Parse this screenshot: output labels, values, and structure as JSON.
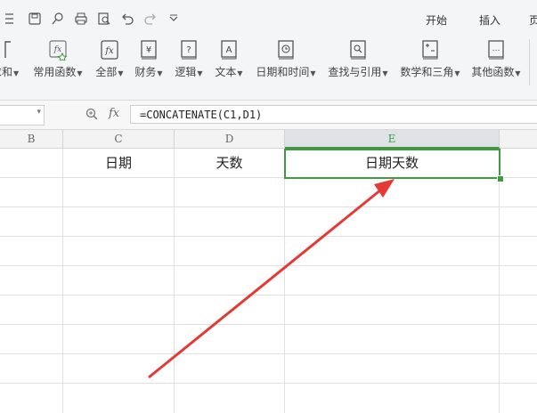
{
  "ribbon": {
    "tabs": [
      {
        "label": "开始"
      },
      {
        "label": "插入"
      },
      {
        "label": "页"
      }
    ],
    "groups": [
      {
        "label": "求和",
        "icon": "sum-icon"
      },
      {
        "label": "常用函数",
        "icon": "fx-star-icon"
      },
      {
        "label": "全部",
        "icon": "fx-icon"
      },
      {
        "label": "财务",
        "icon": "yen-book-icon"
      },
      {
        "label": "逻辑",
        "icon": "question-book-icon"
      },
      {
        "label": "文本",
        "icon": "text-book-icon"
      },
      {
        "label": "日期和时间",
        "icon": "clock-book-icon"
      },
      {
        "label": "查找与引用",
        "icon": "search-book-icon"
      },
      {
        "label": "数学和三角",
        "icon": "math-book-icon"
      },
      {
        "label": "其他函数",
        "icon": "more-book-icon"
      }
    ]
  },
  "formula_bar": {
    "fx_label": "fx",
    "formula": "=CONCATENATE(C1,D1)"
  },
  "sheet": {
    "columns": [
      {
        "label": "B"
      },
      {
        "label": "C"
      },
      {
        "label": "D"
      },
      {
        "label": "E"
      }
    ],
    "row1": {
      "c": "日期",
      "d": "天数",
      "e": "日期天数"
    }
  },
  "colors": {
    "selection": "#3e9b3e",
    "arrow": "#e53935"
  }
}
